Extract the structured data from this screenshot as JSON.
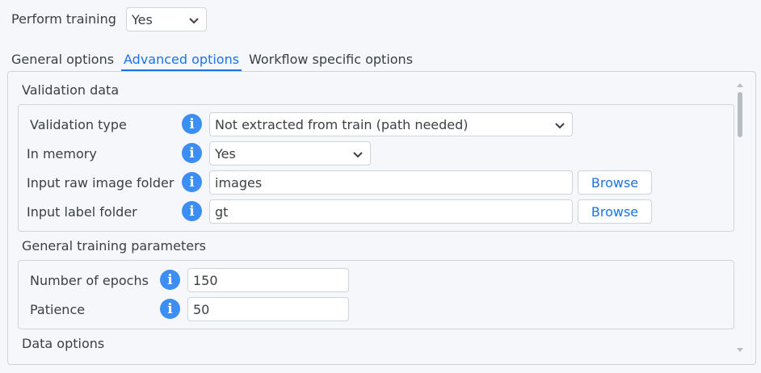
{
  "header": {
    "perform_training_label": "Perform training",
    "perform_training_value": "Yes"
  },
  "tabs": [
    {
      "label": "General options",
      "active": false
    },
    {
      "label": "Advanced options",
      "active": true
    },
    {
      "label": "Workflow specific options",
      "active": false
    }
  ],
  "validation": {
    "title": "Validation data",
    "type_label": "Validation type",
    "type_value": "Not extracted from train (path needed)",
    "in_memory_label": "In memory",
    "in_memory_value": "Yes",
    "raw_folder_label": "Input raw image folder",
    "raw_folder_value": "images",
    "label_folder_label": "Input label folder",
    "label_folder_value": "gt",
    "browse_label": "Browse"
  },
  "training": {
    "title": "General training parameters",
    "epochs_label": "Number of epochs",
    "epochs_value": "150",
    "patience_label": "Patience",
    "patience_value": "50"
  },
  "data_options": {
    "title": "Data options"
  },
  "icons": {
    "info": "info-icon",
    "chevron": "chevron-down-icon"
  },
  "colors": {
    "accent": "#1a73e8",
    "info_bg": "#3c8ef5",
    "background": "#f5f7fa"
  }
}
